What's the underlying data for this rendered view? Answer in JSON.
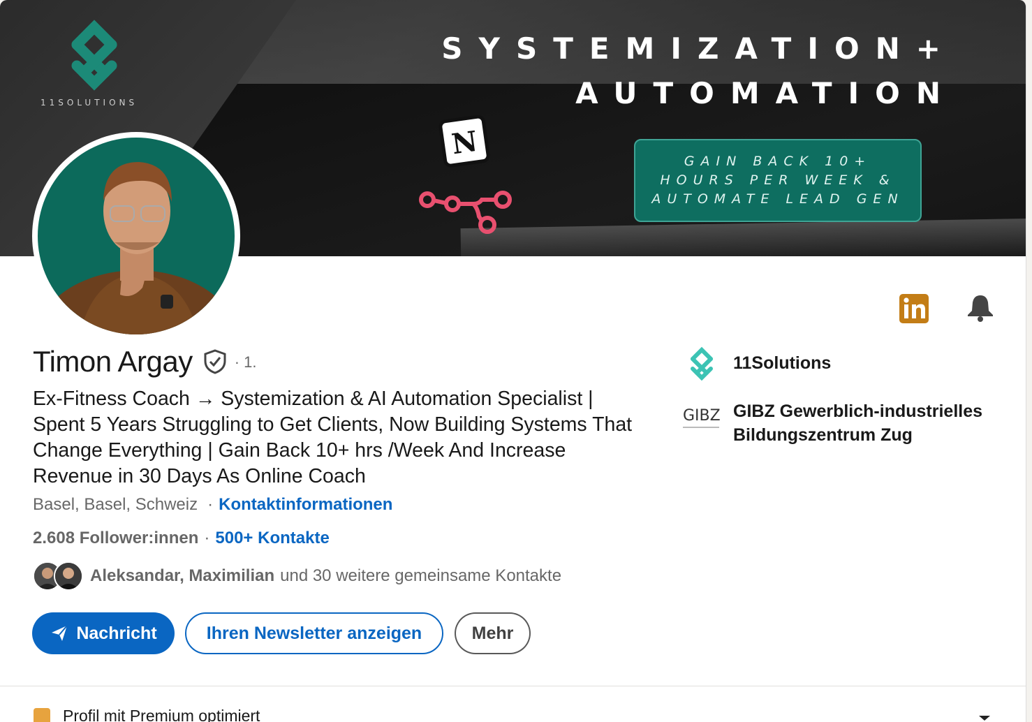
{
  "banner": {
    "brand_name": "11SOLUTIONS",
    "headline_line1": "SYSTEMIZATION+",
    "headline_line2": "AUTOMATION",
    "cta_text": "GAIN BACK 10+ HOURS PER WEEK & AUTOMATE LEAD GEN",
    "brand_color": "#0e6e60"
  },
  "profile": {
    "name": "Timon Argay",
    "degree": "· 1.",
    "headline": "Ex-Fitness Coach → Systemization & AI Automation Specialist | Spent 5 Years Struggling to Get Clients, Now Building Systems That Change Everything | Gain Back 10+ hrs /Week And Increase Revenue in 30 Days As Online Coach",
    "location": "Basel, Basel, Schweiz",
    "contact_info_link": "Kontaktinformationen",
    "followers": "2.608 Follower:innen",
    "separator": "·",
    "connections_link": "500+ Kontakte",
    "mutual_names": "Aleksandar, Maximilian",
    "mutual_rest": "und 30 weitere gemeinsame Kontakte"
  },
  "actions": {
    "message_label": "Nachricht",
    "newsletter_label": "Ihren Newsletter anzeigen",
    "more_label": "Mehr"
  },
  "organizations": [
    {
      "name": "11Solutions",
      "icon": "11solutions-logo"
    },
    {
      "name": "GIBZ Gewerblich-industrielles Bildungszentrum Zug",
      "logo_text": "GIBZ",
      "icon": "gibz-logo"
    }
  ],
  "premium": {
    "label": "Profil mit Premium optimiert",
    "badge_color": "#e7a33e"
  },
  "colors": {
    "primary_blue": "#0a66c2",
    "linkedin_gold": "#c37d16"
  }
}
